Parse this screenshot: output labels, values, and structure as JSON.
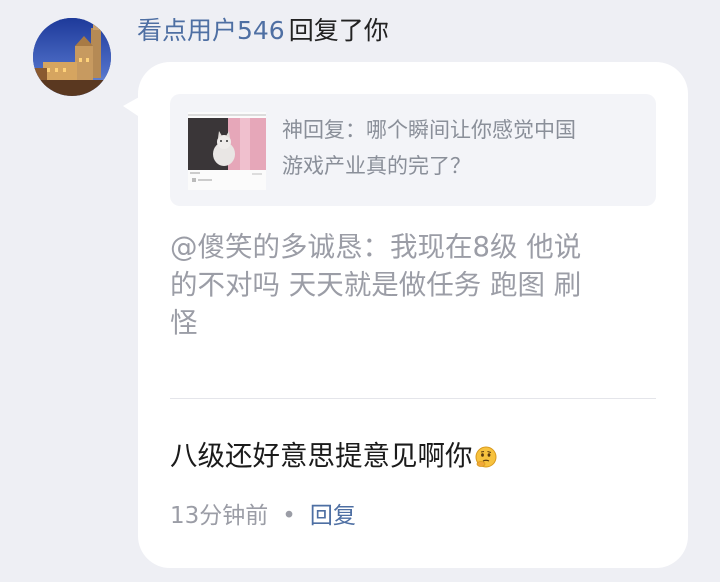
{
  "header": {
    "username": "看点用户546",
    "action": "回复了你"
  },
  "quote": {
    "lines": [
      "神回复：哪个瞬间让你感觉中国",
      "游戏产业真的完了？"
    ]
  },
  "parent_comment": {
    "lines": [
      "@傻笑的多诚恳：我现在8级 他说",
      "的不对吗 天天就是做任务 跑图 刷",
      "怪"
    ]
  },
  "reply": {
    "text": "八级还好意思提意见啊你",
    "emoji_icon": "thinking-emoji-icon"
  },
  "meta": {
    "time": "13分钟前",
    "separator": "•",
    "reply_label": "回复"
  },
  "colors": {
    "accent": "#4e6fa3",
    "background": "#eeeff4",
    "card": "#ffffff",
    "quote_bg": "#f3f4f8",
    "muted_text": "#9b9da6"
  }
}
